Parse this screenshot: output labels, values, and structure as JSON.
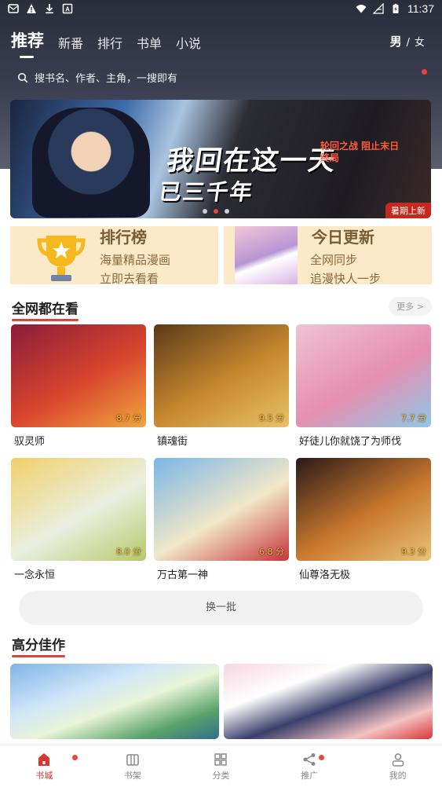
{
  "status_bar": {
    "time": "11:37"
  },
  "top_tabs": [
    {
      "label": "推荐",
      "active": true
    },
    {
      "label": "新番"
    },
    {
      "label": "排行"
    },
    {
      "label": "书单"
    },
    {
      "label": "小说"
    }
  ],
  "gender": {
    "male": "男",
    "separator": "/",
    "female": "女"
  },
  "search": {
    "placeholder": "搜书名、作者、主角，一搜即有"
  },
  "banner": {
    "title_line1": "我回在这一天",
    "title_line2": "已三千年",
    "subtitle": "轮回之战 阻止末日终局",
    "tag": "暑期上新",
    "page_count": 3,
    "current_page": 2
  },
  "promos": [
    {
      "title": "排行榜",
      "line1": "海量精品漫画",
      "line2": "立即去看看"
    },
    {
      "title": "今日更新",
      "line1": "全网同步",
      "line2": "追漫快人一步"
    }
  ],
  "sections": {
    "hot": {
      "title": "全网都在看",
      "more": "更多 >"
    },
    "top_rated": {
      "title": "高分佳作"
    }
  },
  "comics": [
    {
      "name": "驭灵师",
      "score": "8.7 分",
      "colors": [
        "#8a1c3a",
        "#d9452e",
        "#f2a640"
      ]
    },
    {
      "name": "镇魂街",
      "score": "9.5 分",
      "colors": [
        "#5a3a1a",
        "#c9892e",
        "#e7c26a"
      ]
    },
    {
      "name": "好徒儿你就饶了为师伐",
      "score": "7.7 分",
      "colors": [
        "#f0c2d2",
        "#e58fb0",
        "#8fc8e8"
      ]
    },
    {
      "name": "一念永恒",
      "score": "8.0 分",
      "colors": [
        "#f1d06a",
        "#e9efe0",
        "#b6c96a"
      ]
    },
    {
      "name": "万古第一神",
      "score": "6.8 分",
      "colors": [
        "#7ab6e8",
        "#f1e7c8",
        "#c7353a"
      ]
    },
    {
      "name": "仙尊洛无极",
      "score": "9.3 分",
      "colors": [
        "#2a1a18",
        "#c9782e",
        "#e8c47a"
      ]
    }
  ],
  "refresh_button": "换一批",
  "bottom_nav": [
    {
      "label": "书城",
      "icon": "home-icon",
      "active": true,
      "badge": true
    },
    {
      "label": "书架",
      "icon": "bookshelf-icon"
    },
    {
      "label": "分类",
      "icon": "category-icon"
    },
    {
      "label": "推广",
      "icon": "share-icon",
      "badge": true
    },
    {
      "label": "我的",
      "icon": "profile-icon"
    }
  ],
  "colors": {
    "accent": "#e0433b",
    "header_bg": "#2f3342",
    "score": "#f6b53c"
  }
}
